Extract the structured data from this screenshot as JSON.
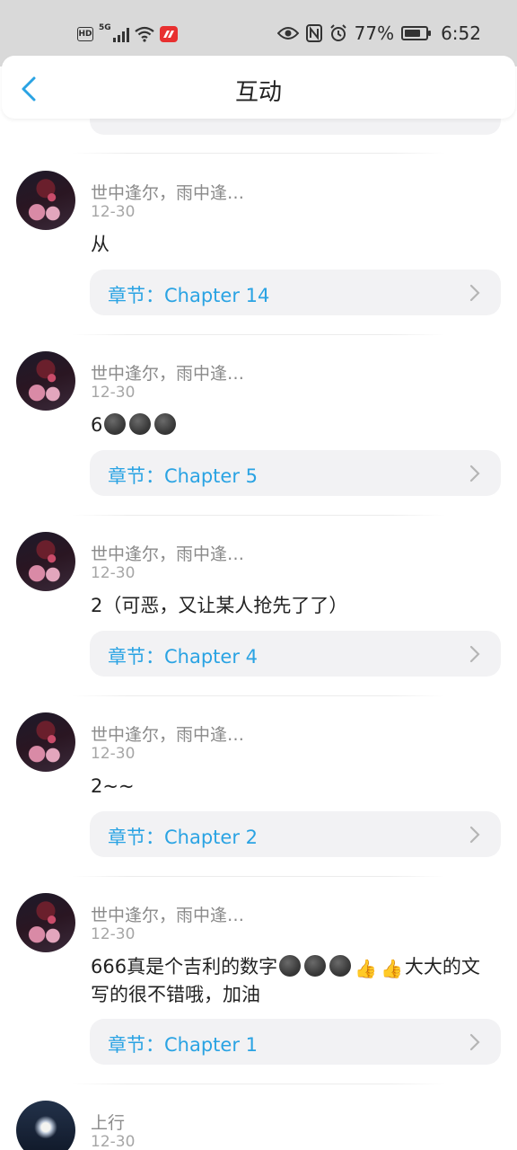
{
  "status_bar": {
    "network_label": "5G",
    "battery_percent": "77%",
    "battery_level": 0.77,
    "time": "6:52"
  },
  "header": {
    "title": "互动"
  },
  "colors": {
    "accent": "#2aa3e3",
    "card_bg": "#f2f2f4",
    "status_bar_bg": "#d9d9d9"
  },
  "comments": [
    {
      "username": "世中逢尔，雨中逢…",
      "date": "12-30",
      "text": "从",
      "chapter": "章节：Chapter 14"
    },
    {
      "username": "世中逢尔，雨中逢…",
      "date": "12-30",
      "text_prefix": "6",
      "chapter": "章节：Chapter 5"
    },
    {
      "username": "世中逢尔，雨中逢…",
      "date": "12-30",
      "text": "2（可恶，又让某人抢先了了）",
      "chapter": "章节：Chapter 4"
    },
    {
      "username": "世中逢尔，雨中逢…",
      "date": "12-30",
      "text": "2~~",
      "chapter": "章节：Chapter 2"
    },
    {
      "username": "世中逢尔，雨中逢…",
      "date": "12-30",
      "text_prefix": "666真是个吉利的数字",
      "text_suffix": "大大的文写的很不错哦，加油",
      "chapter": "章节：Chapter 1"
    },
    {
      "username": "上行",
      "date": "12-30"
    }
  ]
}
